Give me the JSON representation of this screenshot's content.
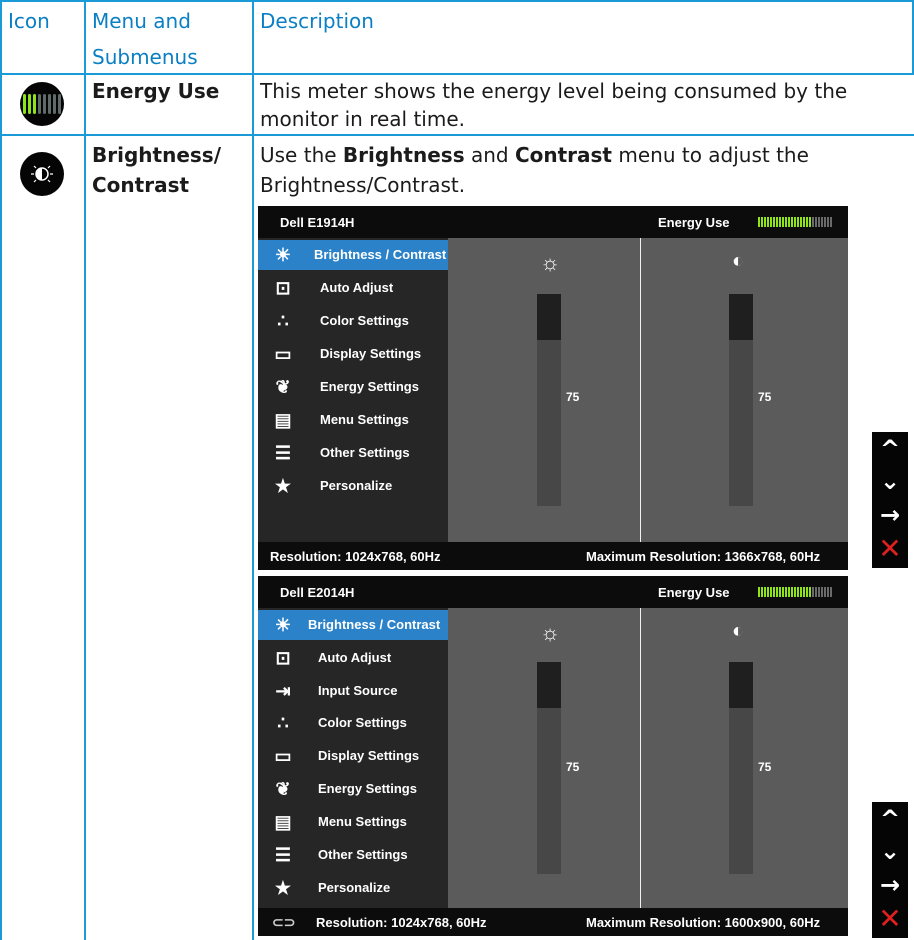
{
  "table": {
    "headers": {
      "icon": "Icon",
      "menu_line1": "Menu and",
      "menu_line2": "Submenus",
      "description": "Description"
    },
    "rows": [
      {
        "icon": "energy-meter-icon",
        "menu": "Energy Use",
        "description_line1": "This meter shows the energy level being consumed by the",
        "description_line2": "monitor in real time."
      },
      {
        "icon": "brightness-contrast-icon",
        "menu_line1": "Brightness/",
        "menu_line2": "Contrast",
        "description_pre": "Use the ",
        "description_b1": "Brightness",
        "description_mid": " and ",
        "description_b2": "Contrast",
        "description_post": " menu to adjust the",
        "description_line2": "Brightness/Contrast."
      }
    ]
  },
  "osd1": {
    "model": "Dell E1914H",
    "energy_label": "Energy Use",
    "menu": [
      {
        "icon": "sun-icon",
        "label": "Brightness / Contrast"
      },
      {
        "icon": "auto-adjust-icon",
        "label": "Auto Adjust"
      },
      {
        "icon": "color-dots-icon",
        "label": "Color Settings"
      },
      {
        "icon": "display-rect-icon",
        "label": "Display Settings"
      },
      {
        "icon": "leaf-icon",
        "label": "Energy Settings"
      },
      {
        "icon": "menu-doc-icon",
        "label": "Menu Settings"
      },
      {
        "icon": "sliders-icon",
        "label": "Other Settings"
      },
      {
        "icon": "star-icon",
        "label": "Personalize"
      }
    ],
    "brightness_value": "75",
    "contrast_value": "75",
    "resolution": "Resolution: 1024x768, 60Hz",
    "max_resolution": "Maximum Resolution: 1366x768, 60Hz"
  },
  "osd2": {
    "model": "Dell E2014H",
    "energy_label": "Energy Use",
    "menu": [
      {
        "icon": "sun-icon",
        "label": "Brightness / Contrast"
      },
      {
        "icon": "auto-adjust-icon",
        "label": "Auto Adjust"
      },
      {
        "icon": "input-source-icon",
        "label": "Input Source"
      },
      {
        "icon": "color-dots-icon",
        "label": "Color Settings"
      },
      {
        "icon": "display-rect-icon",
        "label": "Display Settings"
      },
      {
        "icon": "leaf-icon",
        "label": "Energy Settings"
      },
      {
        "icon": "menu-doc-icon",
        "label": "Menu Settings"
      },
      {
        "icon": "sliders-icon",
        "label": "Other Settings"
      },
      {
        "icon": "star-icon",
        "label": "Personalize"
      }
    ],
    "brightness_value": "75",
    "contrast_value": "75",
    "resolution": "Resolution: 1024x768, 60Hz",
    "max_resolution": "Maximum Resolution: 1600x900, 60Hz"
  },
  "nav_buttons": [
    "up-arrow-icon",
    "down-arrow-icon",
    "right-arrow-icon",
    "close-x-icon"
  ],
  "colors": {
    "header_blue": "#0b7fc4",
    "grid_blue": "#1a9ad6",
    "active_blue": "#2b82c8",
    "energy_green": "#8ee31b",
    "exit_red": "#e0201e"
  }
}
